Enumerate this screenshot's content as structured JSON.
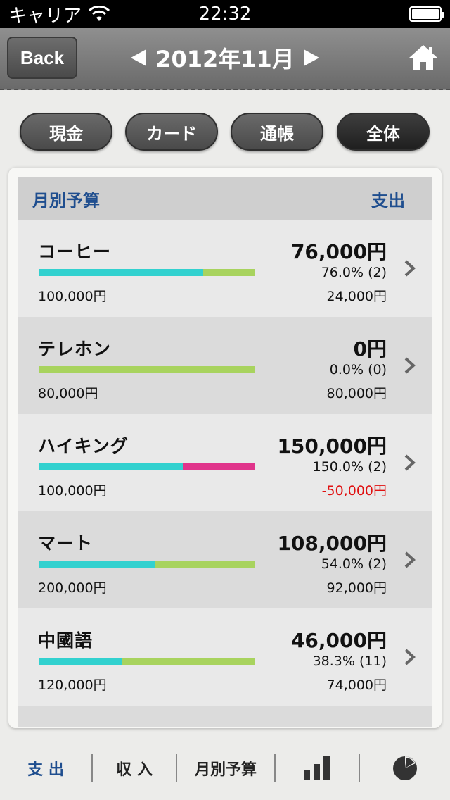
{
  "status_bar": {
    "carrier": "キャリア",
    "time": "22:32"
  },
  "nav": {
    "back_label": "Back",
    "title": "2012年11月",
    "prev_icon": "triangle-left-icon",
    "next_icon": "triangle-right-icon",
    "home_icon": "home-icon"
  },
  "filters": [
    {
      "label": "現金",
      "active": false
    },
    {
      "label": "カード",
      "active": false
    },
    {
      "label": "通帳",
      "active": false
    },
    {
      "label": "全体",
      "active": true
    }
  ],
  "card": {
    "header_left": "月別予算",
    "header_right": "支出"
  },
  "budgets": [
    {
      "name": "コーヒー",
      "budget": "100,000円",
      "spent": "76,000円",
      "pct": "76.0% (2)",
      "remain": "24,000円",
      "ratio": 0.76,
      "over": false
    },
    {
      "name": "テレホン",
      "budget": "80,000円",
      "spent": "0円",
      "pct": "0.0% (0)",
      "remain": "80,000円",
      "ratio": 0.0,
      "over": false
    },
    {
      "name": "ハイキング",
      "budget": "100,000円",
      "spent": "150,000円",
      "pct": "150.0% (2)",
      "remain": "-50,000円",
      "ratio": 1.5,
      "over": true
    },
    {
      "name": "マート",
      "budget": "200,000円",
      "spent": "108,000円",
      "pct": "54.0% (2)",
      "remain": "92,000円",
      "ratio": 0.54,
      "over": false
    },
    {
      "name": "中國語",
      "budget": "120,000円",
      "spent": "46,000円",
      "pct": "38.3% (11)",
      "remain": "74,000円",
      "ratio": 0.383,
      "over": false
    }
  ],
  "colors": {
    "bar_spent": "#32d1cf",
    "bar_remaining": "#a8d35e",
    "bar_over": "#e0348b",
    "negative": "#e01010",
    "accent": "#1f4e8f"
  },
  "tabs": {
    "expense": "支 出",
    "income": "収 入",
    "monthly_budget": "月別予算",
    "bar_chart_icon": "bar-chart-icon",
    "pie_chart_icon": "pie-chart-icon"
  }
}
